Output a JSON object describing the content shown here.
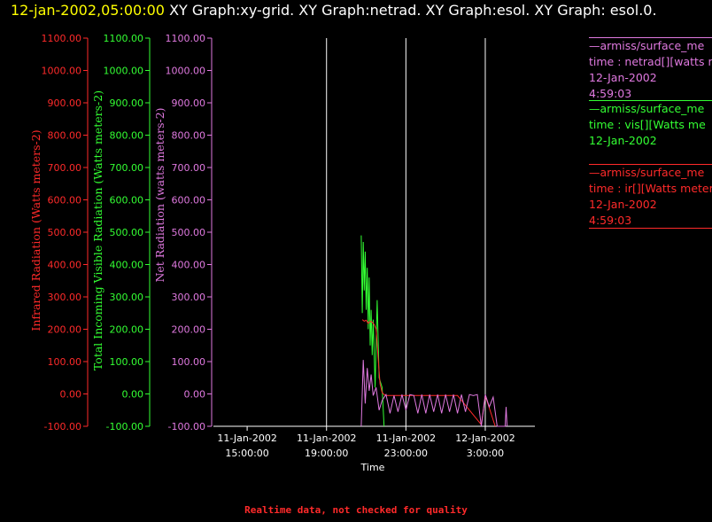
{
  "header": {
    "timestamp": "12-jan-2002,05:00:00",
    "graphs_text": "XY Graph:xy-grid.  XY Graph:netrad.  XY Graph:esol.  XY Graph: esol.0."
  },
  "legend": [
    {
      "source": "—armiss/surface_me",
      "desc": "time : netrad[][watts me",
      "date": "12-Jan-2002",
      "time": "4:59:03",
      "color": "#e079e0"
    },
    {
      "source": "—armiss/surface_me",
      "desc": "time : vis[][Watts me",
      "date": "12-Jan-2002",
      "time": "",
      "color": "#33ff33"
    },
    {
      "source": "—armiss/surface_me",
      "desc": "time : ir[][Watts meters",
      "date": "12-Jan-2002",
      "time": "4:59:03",
      "color": "#ff2a2a"
    }
  ],
  "footer": "Realtime data, not checked for quality",
  "chart_data": {
    "type": "line",
    "xlabel": "Time",
    "x_ticks": [
      {
        "t": 15,
        "label": [
          "11-Jan-2002",
          "15:00:00"
        ]
      },
      {
        "t": 19,
        "label": [
          "11-Jan-2002",
          "19:00:00"
        ]
      },
      {
        "t": 23,
        "label": [
          "11-Jan-2002",
          "23:00:00"
        ]
      },
      {
        "t": 27,
        "label": [
          "12-Jan-2002",
          "3:00:00"
        ]
      }
    ],
    "xlim": [
      13.3,
      29.5
    ],
    "x_units": "hours since 11-Jan-2002 00:00",
    "vertical_grid_at": [
      19,
      23,
      27
    ],
    "y_ticks": [
      1100,
      1000,
      900,
      800,
      700,
      600,
      500,
      400,
      300,
      200,
      100,
      0,
      -100
    ],
    "y_tick_labels": [
      "1100.00",
      "1000.00",
      "900.00",
      "800.00",
      "700.00",
      "600.00",
      "500.00",
      "400.00",
      "300.00",
      "200.00",
      "100.00",
      "0.00",
      "-100.00"
    ],
    "ylim": [
      -100,
      1100
    ],
    "axes": [
      {
        "label": "Infrared Radiation (Watts meters-2)",
        "color": "#ff2a2a"
      },
      {
        "label": "Total Incoming Visible Radiation (Watts meters-2)",
        "color": "#33ff33"
      },
      {
        "label": "Net Radiation (watts meters-2)",
        "color": "#e079e0"
      }
    ],
    "series": [
      {
        "color": "#33ff33",
        "x": [
          20.75,
          20.8,
          20.85,
          20.9,
          20.95,
          21.0,
          21.05,
          21.1,
          21.15,
          21.2,
          21.25,
          21.3,
          21.35,
          21.45,
          21.55,
          21.65,
          21.8,
          21.9
        ],
        "values": [
          490,
          250,
          470,
          320,
          440,
          260,
          390,
          200,
          360,
          150,
          260,
          120,
          230,
          20,
          290,
          50,
          20,
          -100
        ]
      },
      {
        "color": "#ff2a2a",
        "x": [
          20.8,
          20.9,
          21.0,
          21.1,
          21.2,
          21.3,
          21.4,
          21.5,
          21.6,
          21.7,
          21.8,
          21.9,
          22.0,
          22.2,
          24.0,
          25.6,
          26.8,
          27.0,
          27.5
        ],
        "values": [
          230,
          225,
          228,
          218,
          225,
          222,
          215,
          200,
          110,
          30,
          5,
          -2,
          -5,
          -5,
          -5,
          -5,
          -95,
          -5,
          -100
        ]
      },
      {
        "color": "#e079e0",
        "x": [
          20.75,
          20.85,
          20.95,
          21.05,
          21.15,
          21.25,
          21.35,
          21.5,
          21.65,
          21.8,
          22.0,
          22.2,
          22.4,
          22.6,
          22.8,
          23.0,
          23.2,
          23.4,
          23.6,
          23.8,
          24.0,
          24.2,
          24.4,
          24.6,
          24.8,
          25.0,
          25.2,
          25.4,
          25.6,
          25.8,
          26.0,
          26.2,
          26.4,
          26.6,
          26.8,
          27.0,
          27.2,
          27.4,
          27.6,
          28.0,
          28.05,
          28.1
        ],
        "values": [
          -100,
          105,
          -30,
          80,
          10,
          60,
          -5,
          20,
          -50,
          -20,
          -2,
          -60,
          -5,
          -55,
          -2,
          -50,
          -2,
          -5,
          -60,
          -2,
          -60,
          -2,
          -55,
          -2,
          -60,
          -2,
          -55,
          -2,
          -60,
          -2,
          -55,
          -2,
          -5,
          -2,
          -100,
          -2,
          -40,
          -10,
          -100,
          -100,
          -40,
          -100
        ]
      }
    ]
  }
}
